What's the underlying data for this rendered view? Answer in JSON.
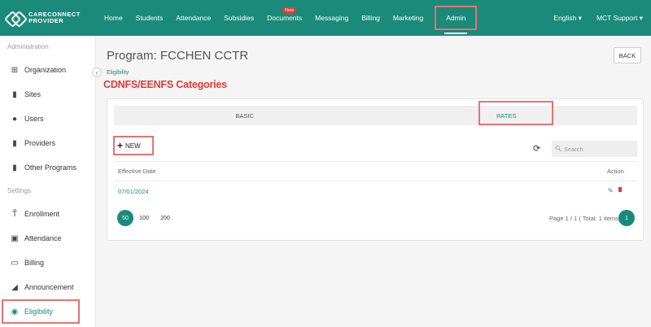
{
  "app": {
    "logo_line1": "CARECONNECT",
    "logo_line2": "PROVIDER"
  },
  "nav": {
    "items": [
      "Home",
      "Students",
      "Attendance",
      "Subsidies",
      "Documents",
      "Messaging",
      "Billing",
      "Marketing",
      "Admin"
    ],
    "documents_badge": "New",
    "language": "English",
    "account": "MCT Support"
  },
  "sidebar": {
    "section1": "Administration",
    "admin_items": [
      "Organization",
      "Sites",
      "Users",
      "Providers",
      "Other Programs"
    ],
    "section2": "Settings",
    "settings_items": [
      "Enrollment",
      "Attendance",
      "Billing",
      "Announcement",
      "Eligibility"
    ]
  },
  "page": {
    "title": "Program: FCCHEN CCTR",
    "breadcrumb": "Eligibility",
    "back_label": "BACK",
    "annotation": "CDNFS/EENFS Categories"
  },
  "tabs": [
    "BASIC",
    "RATES"
  ],
  "toolbar": {
    "new_label": "NEW",
    "search_placeholder": "Search"
  },
  "table": {
    "headers": [
      "Effective Date",
      "Action"
    ],
    "rows": [
      {
        "effective_date": "07/01/2024"
      }
    ]
  },
  "pagination": {
    "sizes": [
      "50",
      "100",
      "200"
    ],
    "info": "Page 1 / 1 ( Total: 1 items )",
    "current": "1"
  },
  "colors": {
    "primary": "#1a8a7a",
    "highlight": "#e57373",
    "danger": "#e53935"
  }
}
